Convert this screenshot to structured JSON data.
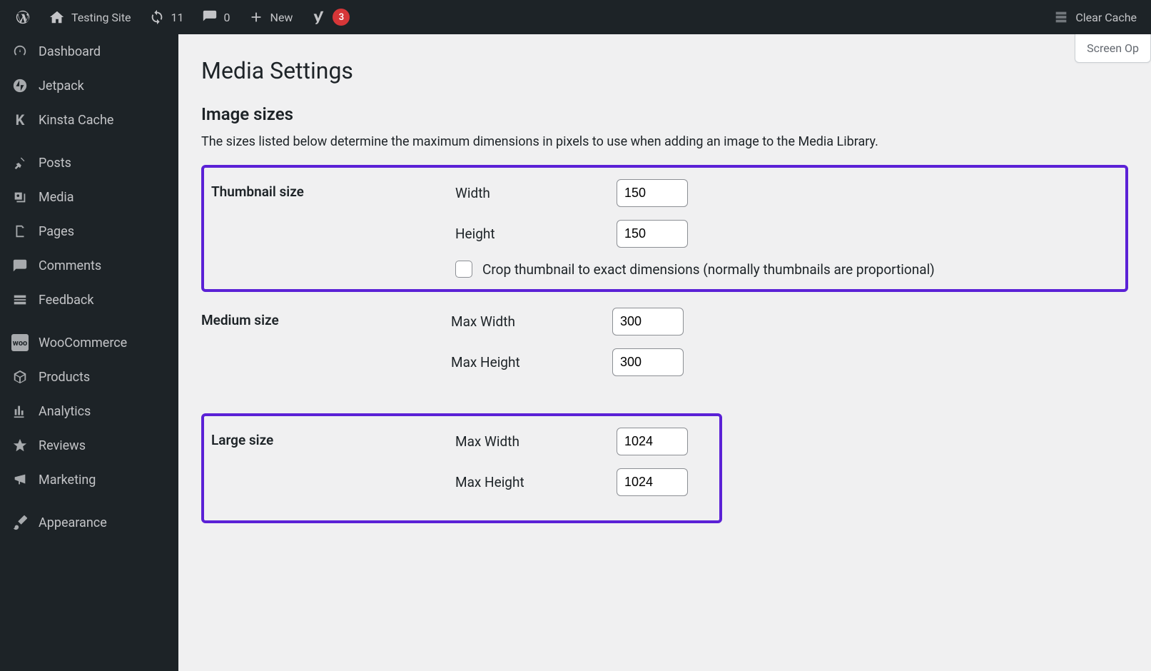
{
  "topbar": {
    "site_name": "Testing Site",
    "updates_count": "11",
    "comments_count": "0",
    "new_label": "New",
    "yoast_badge": "3",
    "clear_cache": "Clear Cache"
  },
  "sidebar": {
    "items": [
      {
        "label": "Dashboard",
        "icon": "dashboard"
      },
      {
        "label": "Jetpack",
        "icon": "jetpack"
      },
      {
        "label": "Kinsta Cache",
        "icon": "kinsta"
      },
      {
        "label": "Posts",
        "icon": "pin"
      },
      {
        "label": "Media",
        "icon": "media"
      },
      {
        "label": "Pages",
        "icon": "pages"
      },
      {
        "label": "Comments",
        "icon": "comment"
      },
      {
        "label": "Feedback",
        "icon": "feedback"
      },
      {
        "label": "WooCommerce",
        "icon": "woo"
      },
      {
        "label": "Products",
        "icon": "box"
      },
      {
        "label": "Analytics",
        "icon": "analytics"
      },
      {
        "label": "Reviews",
        "icon": "star"
      },
      {
        "label": "Marketing",
        "icon": "megaphone"
      },
      {
        "label": "Appearance",
        "icon": "brush"
      }
    ]
  },
  "main": {
    "screen_options": "Screen Op",
    "title": "Media Settings",
    "section_title": "Image sizes",
    "description": "The sizes listed below determine the maximum dimensions in pixels to use when adding an image to the Media Library.",
    "thumbnail": {
      "label": "Thumbnail size",
      "width_label": "Width",
      "width_value": "150",
      "height_label": "Height",
      "height_value": "150",
      "crop_label": "Crop thumbnail to exact dimensions (normally thumbnails are proportional)"
    },
    "medium": {
      "label": "Medium size",
      "width_label": "Max Width",
      "width_value": "300",
      "height_label": "Max Height",
      "height_value": "300"
    },
    "large": {
      "label": "Large size",
      "width_label": "Max Width",
      "width_value": "1024",
      "height_label": "Max Height",
      "height_value": "1024"
    }
  }
}
